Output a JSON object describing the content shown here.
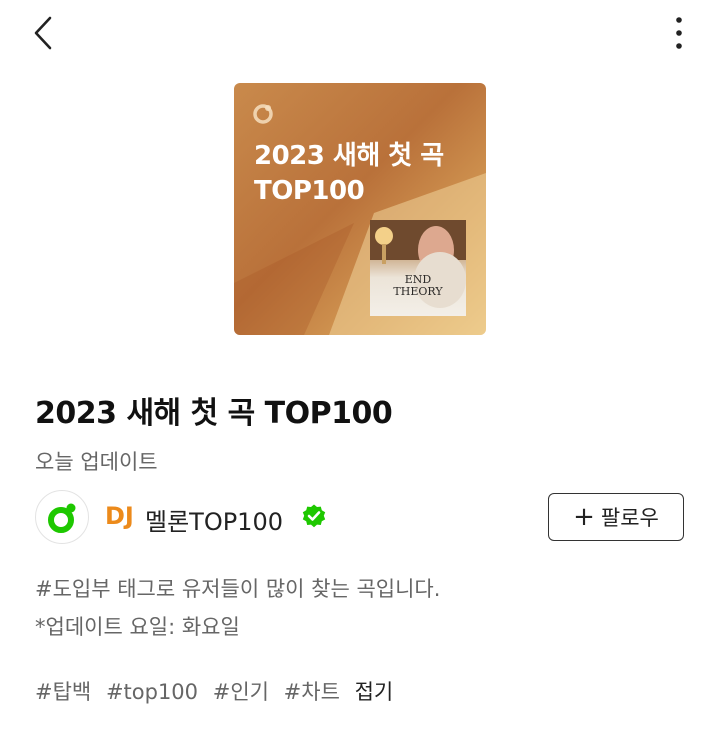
{
  "header": {
    "back_icon": "chevron-left-icon",
    "more_icon": "more-vertical-icon"
  },
  "cover": {
    "title_line1": "2023 새해 첫 곡",
    "title_line2": "TOP100",
    "album_text_line1": "END",
    "album_text_line2": "THEORY",
    "gradient_colors": [
      "#c98a4c",
      "#b9713a",
      "#e9c27b"
    ]
  },
  "playlist": {
    "title": "2023 새해 첫 곡 TOP100",
    "updated": "오늘 업데이트"
  },
  "dj": {
    "label": "DJ",
    "name": "멜론TOP100",
    "label_color": "#ec8a1b",
    "verified_color": "#1ec800",
    "follow_label": "팔로우",
    "follow_icon": "plus-icon"
  },
  "description": {
    "line1": "#도입부 태그로 유저들이 많이 찾는 곡입니다.",
    "line2": "*업데이트 요일: 화요일"
  },
  "tags": {
    "items": [
      "#탑백",
      "#top100",
      "#인기",
      "#차트"
    ],
    "fold_label": "접기"
  }
}
